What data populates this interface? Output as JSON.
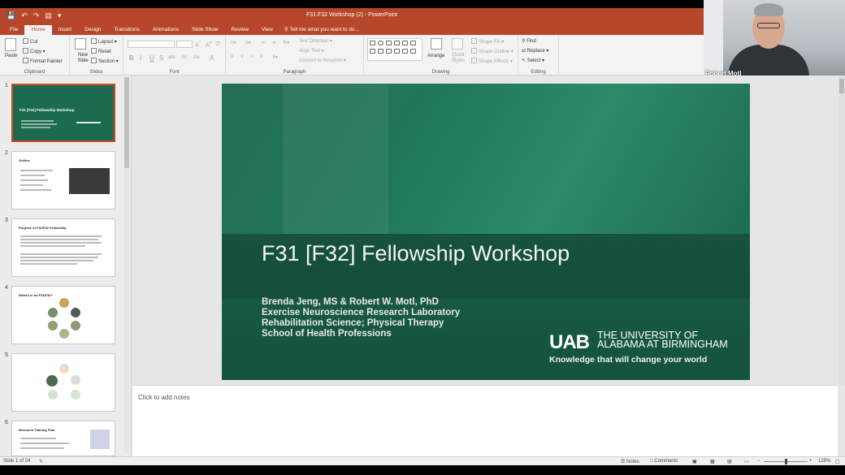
{
  "window": {
    "title": "F31.F32 Workshop (2) - PowerPoint"
  },
  "ribbon_tabs": [
    "File",
    "Home",
    "Insert",
    "Design",
    "Transitions",
    "Animations",
    "Slide Show",
    "Review",
    "View"
  ],
  "active_tab": "Home",
  "tell_me": "Tell me what you want to do...",
  "clipboard": {
    "paste": "Paste",
    "cut": "Cut",
    "copy": "Copy",
    "format_painter": "Format Painter",
    "label": "Clipboard"
  },
  "slides_group": {
    "new_slide": "New Slide",
    "layout": "Layout",
    "reset": "Reset",
    "section": "Section",
    "label": "Slides"
  },
  "font_group": {
    "label": "Font"
  },
  "paragraph_group": {
    "text_direction": "Text Direction",
    "align_text": "Align Text",
    "convert_smartart": "Convert to SmartArt",
    "label": "Paragraph"
  },
  "drawing_group": {
    "arrange": "Arrange",
    "quick_styles": "Quick Styles",
    "shape_fill": "Shape Fill",
    "shape_outline": "Shape Outline",
    "shape_effects": "Shape Effects",
    "label": "Drawing"
  },
  "editing_group": {
    "find": "Find",
    "replace": "Replace",
    "select": "Select",
    "label": "Editing"
  },
  "webcam": {
    "name": "Robert Motl"
  },
  "thumbnails": [
    {
      "num": "1",
      "title": "F31 [F32] Fellowship Workshop"
    },
    {
      "num": "2",
      "title": "Outline"
    },
    {
      "num": "3",
      "title": "Purpose of F31/F32 Fellowship"
    },
    {
      "num": "4",
      "title": "What's in an F31/F32?"
    },
    {
      "num": "5",
      "title": ""
    },
    {
      "num": "6",
      "title": "Research Training Plan"
    }
  ],
  "slide": {
    "title": "F31 [F32] Fellowship Workshop",
    "authors": [
      "Brenda Jeng, MS & Robert W. Motl, PhD",
      "Exercise Neuroscience Research Laboratory",
      "Rehabilitation Science; Physical Therapy",
      "School of Health Professions"
    ],
    "logo": "UAB",
    "university": [
      "THE UNIVERSITY OF",
      "ALABAMA AT BIRMINGHAM"
    ],
    "tagline": "Knowledge that will change your world"
  },
  "notes_placeholder": "Click to add notes",
  "status": {
    "slide_count": "Slide 1 of 24",
    "notes": "Notes",
    "comments": "Comments",
    "zoom": "128%"
  },
  "colors": {
    "accent": "#b7472a",
    "slide_green": "#1a6a4d",
    "selection": "#d24726"
  }
}
